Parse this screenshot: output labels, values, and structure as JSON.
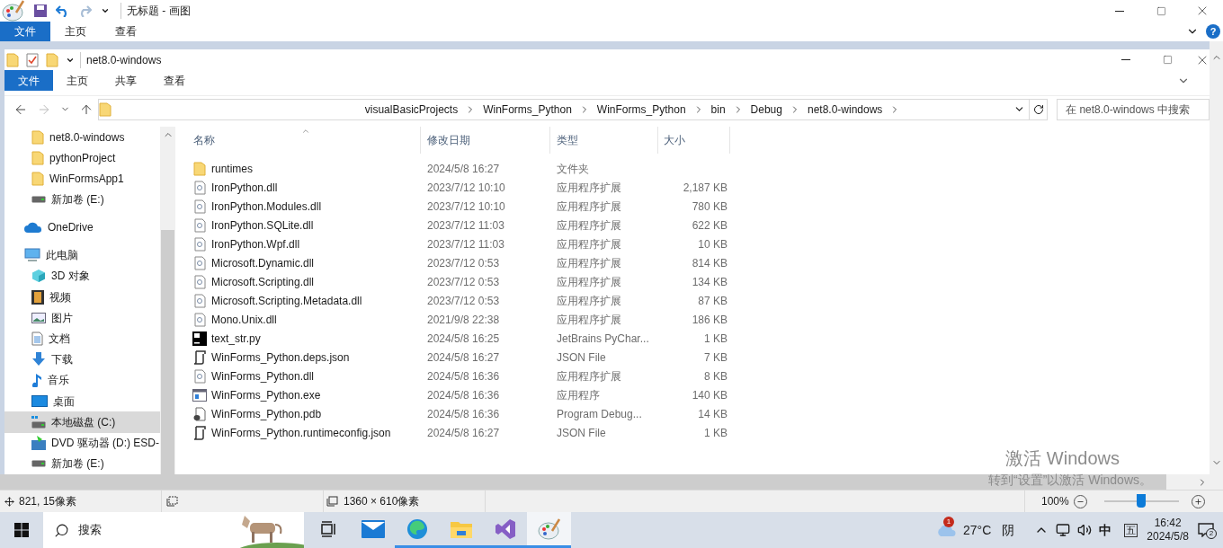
{
  "paint": {
    "title": "无标题 - 画图",
    "help": "?",
    "tabs": [
      {
        "label": "文件",
        "selected": true
      },
      {
        "label": "主页",
        "selected": false
      },
      {
        "label": "查看",
        "selected": false
      }
    ]
  },
  "explorer": {
    "title": "net8.0-windows",
    "tabs": [
      {
        "label": "文件",
        "selected": true
      },
      {
        "label": "主页",
        "selected": false
      },
      {
        "label": "共享",
        "selected": false
      },
      {
        "label": "查看",
        "selected": false
      }
    ],
    "breadcrumb": [
      "visualBasicProjects",
      "WinForms_Python",
      "WinForms_Python",
      "bin",
      "Debug",
      "net8.0-windows"
    ],
    "search": {
      "placeholder": "在 net8.0-windows 中搜索"
    },
    "quick_access": [
      {
        "label": "net8.0-windows",
        "kind": "folder",
        "selected": false
      },
      {
        "label": "pythonProject",
        "kind": "folder",
        "selected": false
      },
      {
        "label": "WinFormsApp1",
        "kind": "folder",
        "selected": false
      },
      {
        "label": "新加卷 (E:)",
        "kind": "drive",
        "selected": false
      }
    ],
    "tree": [
      {
        "label": "OneDrive",
        "kind": "cloud",
        "selected": false
      },
      {
        "label": "此电脑",
        "kind": "pc",
        "selected": false,
        "children": [
          {
            "label": "3D 对象",
            "kind": "cube",
            "selected": false
          },
          {
            "label": "视频",
            "kind": "video",
            "selected": false
          },
          {
            "label": "图片",
            "kind": "picture",
            "selected": false
          },
          {
            "label": "文档",
            "kind": "document",
            "selected": false
          },
          {
            "label": "下载",
            "kind": "download",
            "selected": false
          },
          {
            "label": "音乐",
            "kind": "music",
            "selected": false
          },
          {
            "label": "桌面",
            "kind": "desktop",
            "selected": false
          },
          {
            "label": "本地磁盘 (C:)",
            "kind": "system-drive",
            "selected": true
          },
          {
            "label": "DVD 驱动器 (D:) ESD-",
            "kind": "dvd",
            "selected": false
          },
          {
            "label": "新加卷 (E:)",
            "kind": "drive",
            "selected": false
          }
        ]
      }
    ],
    "columns": [
      "名称",
      "修改日期",
      "类型",
      "大小"
    ],
    "files": [
      {
        "name": "runtimes",
        "date": "2024/5/8 16:27",
        "type": "文件夹",
        "kind": "folder"
      },
      {
        "name": "IronPython.dll",
        "date": "2023/7/12 10:10",
        "type": "应用程序扩展",
        "size": "2,187 KB",
        "kind": "dll"
      },
      {
        "name": "IronPython.Modules.dll",
        "date": "2023/7/12 10:10",
        "type": "应用程序扩展",
        "size": "780 KB",
        "kind": "dll"
      },
      {
        "name": "IronPython.SQLite.dll",
        "date": "2023/7/12 11:03",
        "type": "应用程序扩展",
        "size": "622 KB",
        "kind": "dll"
      },
      {
        "name": "IronPython.Wpf.dll",
        "date": "2023/7/12 11:03",
        "type": "应用程序扩展",
        "size": "10 KB",
        "kind": "dll"
      },
      {
        "name": "Microsoft.Dynamic.dll",
        "date": "2023/7/12 0:53",
        "type": "应用程序扩展",
        "size": "814 KB",
        "kind": "dll"
      },
      {
        "name": "Microsoft.Scripting.dll",
        "date": "2023/7/12 0:53",
        "type": "应用程序扩展",
        "size": "134 KB",
        "kind": "dll"
      },
      {
        "name": "Microsoft.Scripting.Metadata.dll",
        "date": "2023/7/12 0:53",
        "type": "应用程序扩展",
        "size": "87 KB",
        "kind": "dll"
      },
      {
        "name": "Mono.Unix.dll",
        "date": "2021/9/8 22:38",
        "type": "应用程序扩展",
        "size": "186 KB",
        "kind": "dll"
      },
      {
        "name": "text_str.py",
        "date": "2024/5/8 16:25",
        "type": "JetBrains PyChar...",
        "size": "1 KB",
        "kind": "pycharm"
      },
      {
        "name": "WinForms_Python.deps.json",
        "date": "2024/5/8 16:27",
        "type": "JSON File",
        "size": "7 KB",
        "kind": "json"
      },
      {
        "name": "WinForms_Python.dll",
        "date": "2024/5/8 16:36",
        "type": "应用程序扩展",
        "size": "8 KB",
        "kind": "dll"
      },
      {
        "name": "WinForms_Python.exe",
        "date": "2024/5/8 16:36",
        "type": "应用程序",
        "size": "140 KB",
        "kind": "exe"
      },
      {
        "name": "WinForms_Python.pdb",
        "date": "2024/5/8 16:36",
        "type": "Program Debug...",
        "size": "14 KB",
        "kind": "pdb"
      },
      {
        "name": "WinForms_Python.runtimeconfig.json",
        "date": "2024/5/8 16:27",
        "type": "JSON File",
        "size": "1 KB",
        "kind": "json"
      }
    ]
  },
  "activation": {
    "title": "激活 Windows",
    "hint": "转到“设置”以激活 Windows。"
  },
  "status_bar": {
    "position": "821, 15像素",
    "size": "1360 × 610像素",
    "zoom": "100%",
    "level": 0.5
  },
  "taskbar": {
    "search": {
      "placeholder": "搜索"
    },
    "apps": [
      {
        "kind": "taskview",
        "running": false,
        "selected": false
      },
      {
        "kind": "mail",
        "running": false,
        "selected": false
      },
      {
        "kind": "edge",
        "running": true,
        "selected": false
      },
      {
        "kind": "explorer",
        "running": true,
        "selected": false
      },
      {
        "kind": "vs",
        "running": true,
        "selected": false
      },
      {
        "kind": "paint",
        "running": true,
        "selected": true
      }
    ],
    "weather_badge": "1",
    "temperature": "27°C",
    "condition": "阴",
    "ime": "中",
    "ime_mode": "五",
    "time": "16:42",
    "date": "2024/5/8",
    "notifications": "2"
  }
}
